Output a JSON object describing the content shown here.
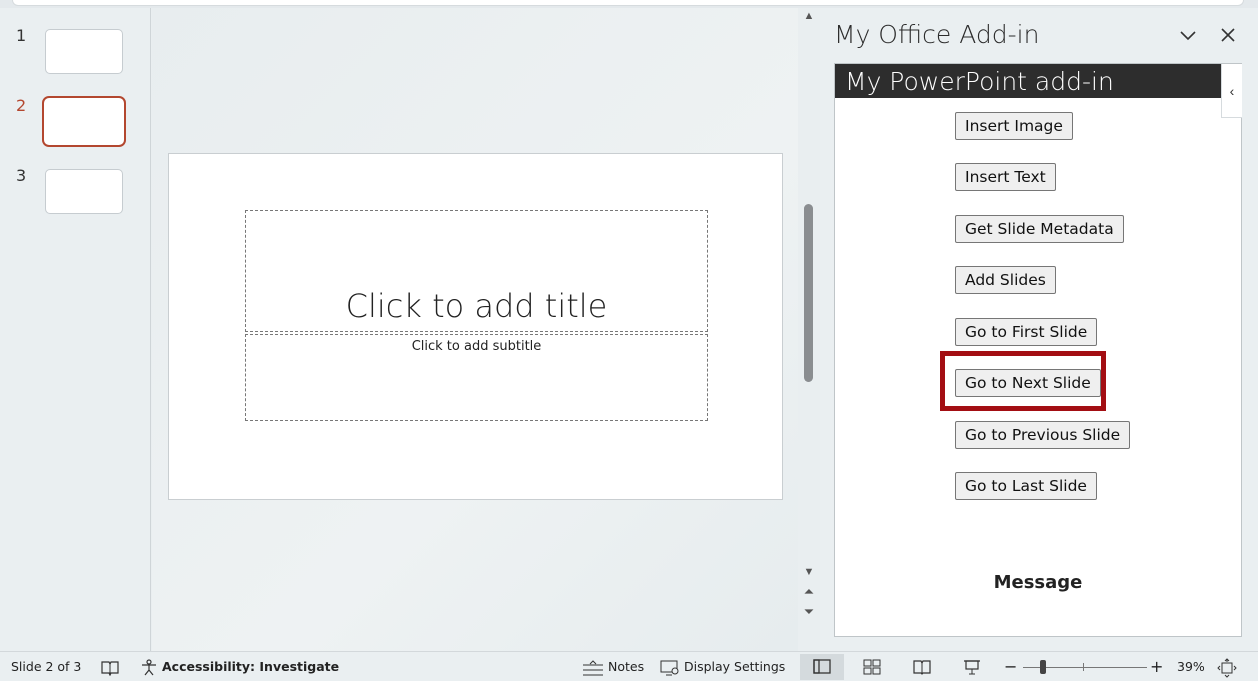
{
  "thumbnails": [
    {
      "number": "1",
      "selected": false
    },
    {
      "number": "2",
      "selected": true
    },
    {
      "number": "3",
      "selected": false
    }
  ],
  "slide": {
    "title_placeholder": "Click to add title",
    "subtitle_placeholder": "Click to add subtitle"
  },
  "taskpane": {
    "title": "My Office Add-in",
    "header": "My PowerPoint add-in",
    "buttons": [
      "Insert Image",
      "Insert Text",
      "Get Slide Metadata",
      "Add Slides",
      "Go to First Slide",
      "Go to Next Slide",
      "Go to Previous Slide",
      "Go to Last Slide"
    ],
    "highlighted_button": "Go to Next Slide",
    "message_label": "Message"
  },
  "statusbar": {
    "slide_info": "Slide 2 of 3",
    "accessibility": "Accessibility: Investigate",
    "notes": "Notes",
    "display_settings": "Display Settings",
    "zoom_level": "39%",
    "zoom_fraction": 0.17
  },
  "colors": {
    "selected_accent": "#b3472f",
    "highlight_box": "#a30e13",
    "addin_header_bg": "#2d2d2d"
  }
}
